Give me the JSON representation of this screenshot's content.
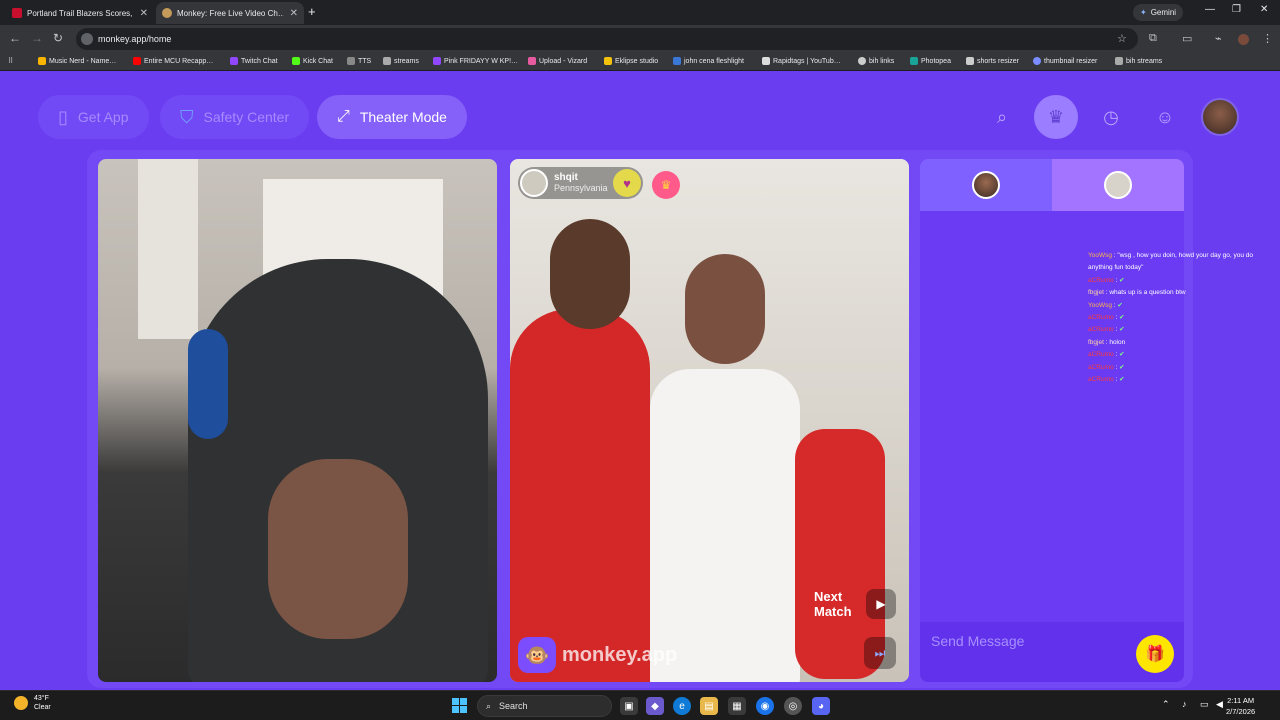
{
  "tabs": [
    {
      "title": "Portland Trail Blazers Scores, St…",
      "active": false
    },
    {
      "title": "Monkey: Free Live Video Ch…",
      "active": true
    }
  ],
  "gemini_label": "Gemini",
  "address": "monkey.app/home",
  "bookmarks": [
    "Music Nerd - Name…",
    "Entire MCU Recapp…",
    "Twitch Chat",
    "Kick Chat",
    "TTS",
    "streams",
    "Pink FRIDAYY W KP!…",
    "Upload - Vizard",
    "Eklipse studio",
    "john cena fleshlight",
    "Rapidtags | YouTub…",
    "bih links",
    "Photopea",
    "shorts resizer",
    "thumbnail resizer",
    "bih streams"
  ],
  "nav": {
    "get_app": "Get App",
    "safety": "Safety Center",
    "theater": "Theater Mode"
  },
  "match": {
    "name": "shqit",
    "location": "Pennsylvania"
  },
  "next_match": "Next Match",
  "brand": "monkey.app",
  "send_placeholder": "Send Message",
  "overlay_chat": [
    {
      "user": "YooWsg",
      "msg": ": \"wsg , how you doin, howd your day go, you do anything fun today\""
    },
    {
      "user": "aCRumo",
      "msg": ":"
    },
    {
      "user": "fbgjet",
      "msg": ": whats up is a question btw"
    },
    {
      "user": "YooWsg",
      "msg": ":"
    },
    {
      "user": "aCRumo",
      "msg": ":"
    },
    {
      "user": "aCRumo",
      "msg": ":"
    },
    {
      "user": "fbgjet",
      "msg": ": holon"
    },
    {
      "user": "aCRumo",
      "msg": ":"
    },
    {
      "user": "aCRumo",
      "msg": ":"
    },
    {
      "user": "aCRumo",
      "msg": ":"
    }
  ],
  "taskbar": {
    "temp": "43°F",
    "condition": "Clear",
    "search": "Search",
    "time": "2:11 AM",
    "date": "2/7/2026"
  },
  "colors": {
    "page_bg": "#6b3df0",
    "accent": "#7c4dff",
    "gift": "#ffe600"
  }
}
